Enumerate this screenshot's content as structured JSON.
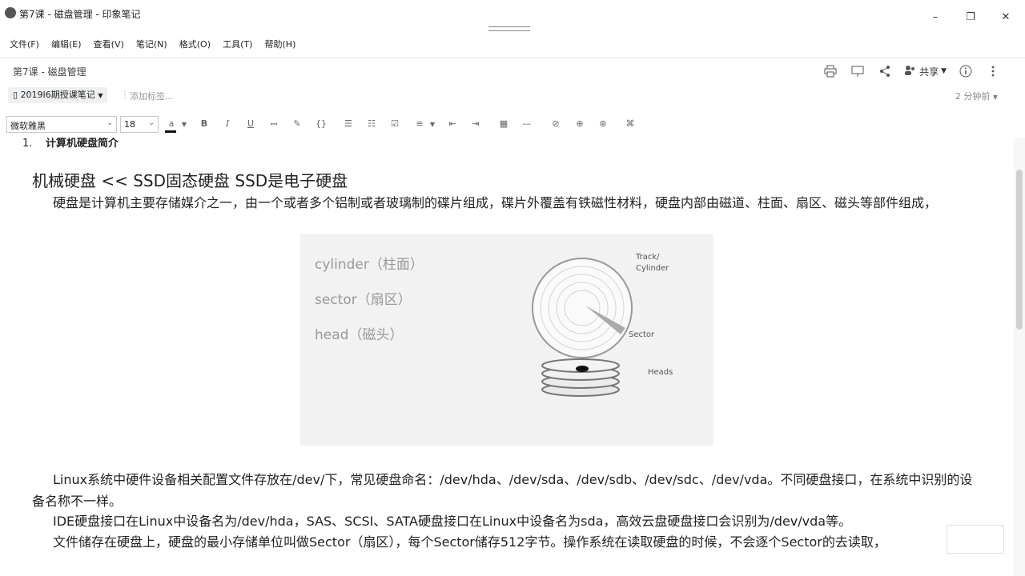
{
  "window": {
    "title": "第7课 - 磁盘管理 - 印象笔记",
    "controls": [
      "–",
      "❐",
      "✕"
    ]
  },
  "menu": [
    "文件(F)",
    "编辑(E)",
    "查看(V)",
    "笔记(N)",
    "格式(O)",
    "工具(T)",
    "帮助(H)"
  ],
  "note_header": {
    "title": "第7课 - 磁盘管理",
    "share_label": "共享"
  },
  "tagbar": {
    "notebook": "2019I6期授课笔记",
    "tag_placeholder": "添加标签...",
    "time": "2 分钟前"
  },
  "toolbar": {
    "font": "微软雅黑",
    "size": "18"
  },
  "document": {
    "heading_number": "1.",
    "heading": "计算机硬盘简介",
    "big_line": "机械硬盘  <<  SSD固态硬盘     SSD是电子硬盘",
    "paragraph1": "硬盘是计算机主要存储媒介之一，由一个或者多个铝制或者玻璃制的碟片组成，碟片外覆盖有铁磁性材料，硬盘内部由磁道、柱面、扇区、磁头等部件组成，",
    "paragraph2": "Linux系统中硬件设备相关配置文件存放在/dev/下，常见硬盘命名：/dev/hda、/dev/sda、/dev/sdb、/dev/sdc、/dev/vda。不同硬盘接口，在系统中识别的设备名称不一样。",
    "paragraph3": "IDE硬盘接口在Linux中设备名为/dev/hda，SAS、SCSI、SATA硬盘接口在Linux中设备名为sda，高效云盘硬盘接口会识别为/dev/vda等。",
    "paragraph4": "文件储存在硬盘上，硬盘的最小存储单位叫做Sector（扇区），每个Sector储存512字节。操作系统在读取硬盘的时候，不会逐个Sector的去读取，"
  },
  "diagram": {
    "bullets": [
      "cylinder（柱面）",
      "sector（扇区）",
      "head（磁头）"
    ],
    "labels": {
      "track": "Track/",
      "cylinder": "Cylinder",
      "sector": "Sector",
      "heads": "Heads"
    }
  }
}
